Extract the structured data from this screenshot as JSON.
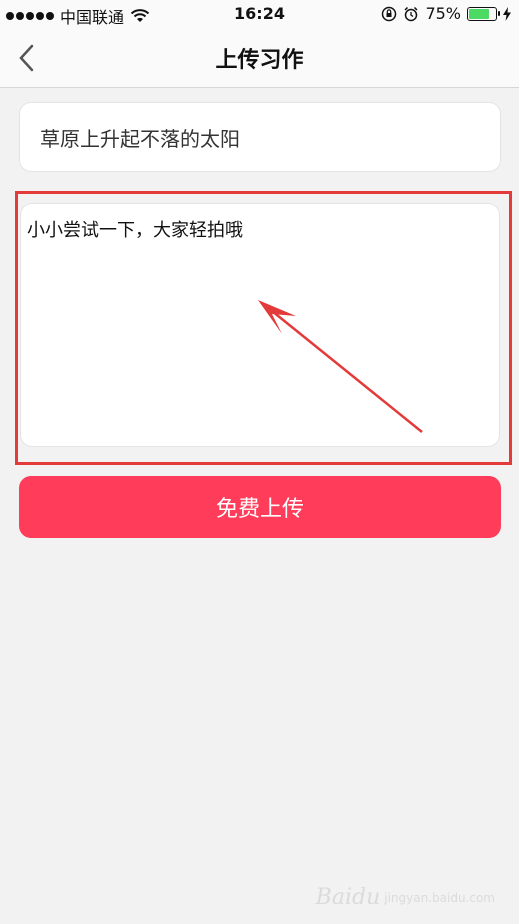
{
  "status_bar": {
    "carrier": "中国联通",
    "time": "16:24",
    "battery_percent": "75%",
    "battery_level": 0.75,
    "battery_color": "#4cd964"
  },
  "nav": {
    "title": "上传习作",
    "back_icon": "chevron-left-icon"
  },
  "form": {
    "title_value": "草原上升起不落的太阳",
    "content_value": "小小尝试一下，大家轻拍哦",
    "submit_label": "免费上传"
  },
  "colors": {
    "accent": "#ff3d5a",
    "highlight": "#e33a3a"
  },
  "watermark": {
    "brand": "Baidu",
    "sub": "jingyan.baidu.com"
  }
}
